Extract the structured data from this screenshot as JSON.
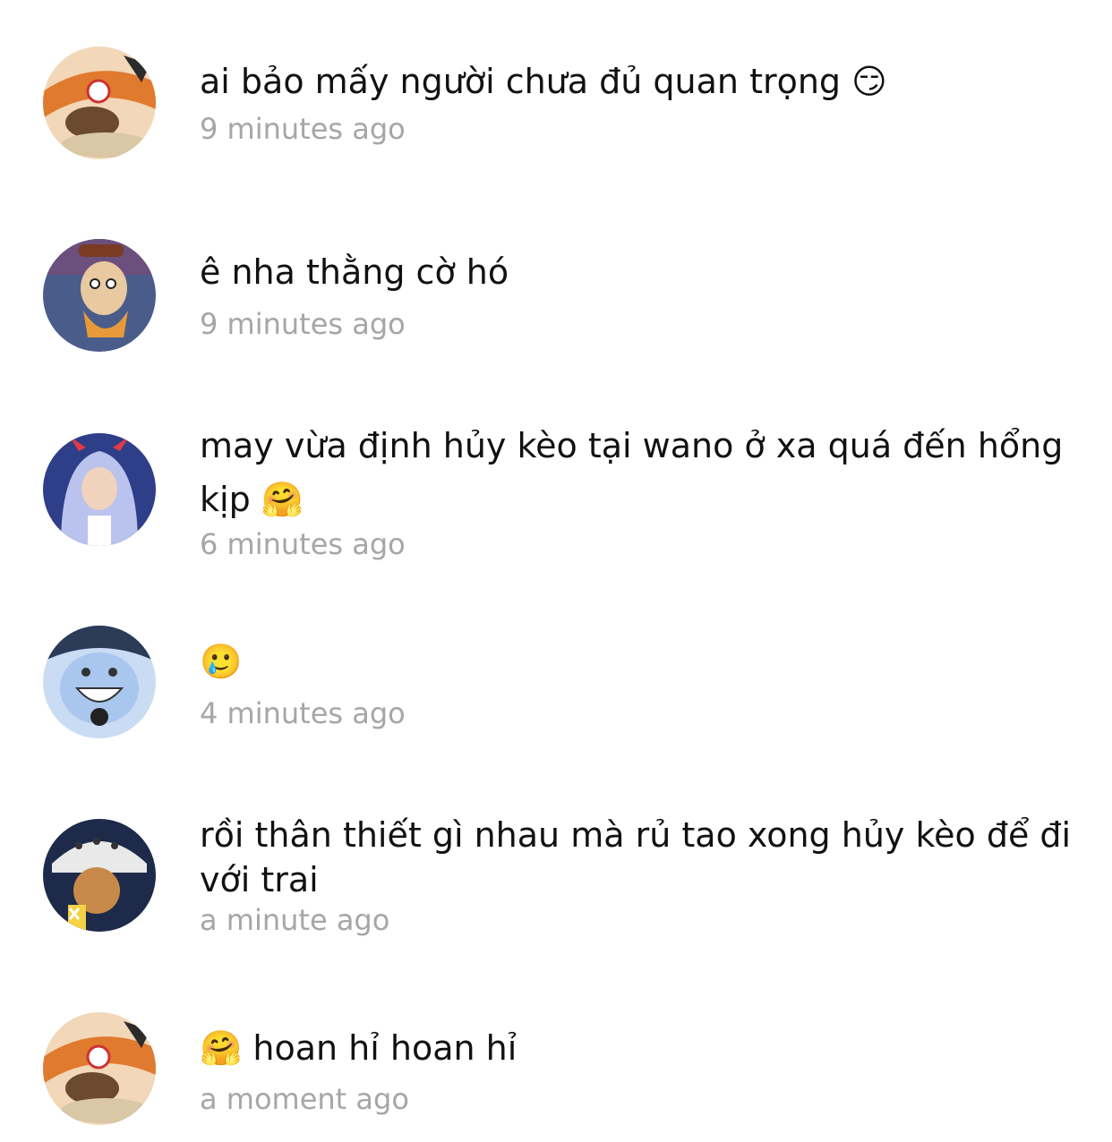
{
  "comments": [
    {
      "avatar": "ace-avatar",
      "text": "ai bảo mấy người chưa đủ quan trọng 😏",
      "time": "9 minutes ago"
    },
    {
      "avatar": "usopp-avatar",
      "text": "ê nha thằng cờ hó",
      "time": "9 minutes ago"
    },
    {
      "avatar": "yamato-avatar",
      "text": "may vừa định hủy kèo tại wano ở xa quá đến hổng kịp 🤗",
      "time": "6 minutes ago"
    },
    {
      "avatar": "jinbe-avatar",
      "text": "🥲",
      "time": "4 minutes ago"
    },
    {
      "avatar": "law-avatar",
      "text": "rồi thân thiết gì nhau mà rủ tao xong hủy kèo để đi với trai",
      "time": "a minute ago"
    },
    {
      "avatar": "ace-avatar",
      "text": "🤗  hoan hỉ hoan hỉ",
      "time": "a moment ago"
    }
  ]
}
